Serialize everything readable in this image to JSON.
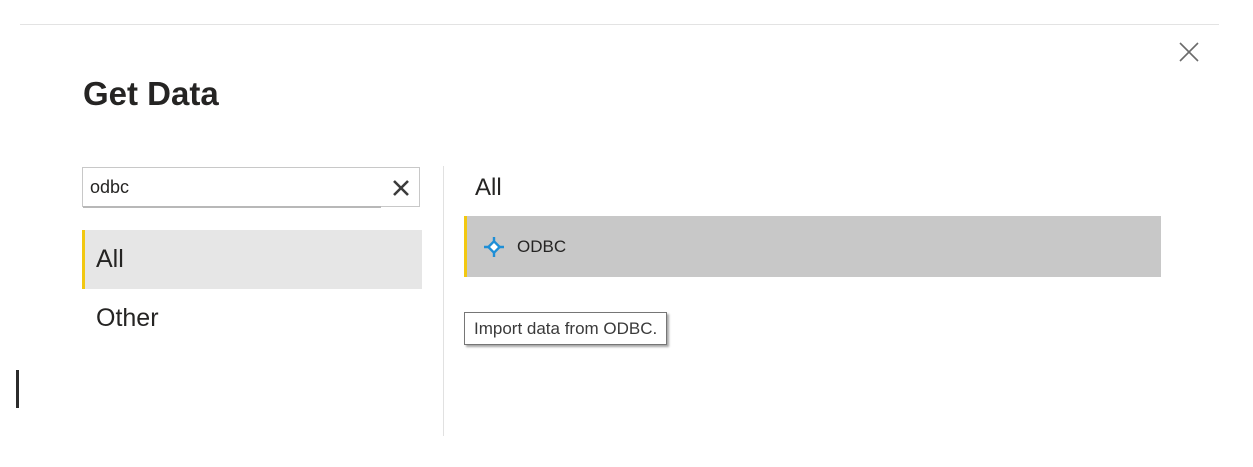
{
  "dialog": {
    "title": "Get Data",
    "close_icon": "close-icon"
  },
  "search": {
    "value": "odbc",
    "placeholder": "",
    "clear_icon": "clear-x-icon"
  },
  "categories": [
    {
      "label": "All",
      "selected": true
    },
    {
      "label": "Other",
      "selected": false
    }
  ],
  "results": {
    "heading": "All",
    "items": [
      {
        "label": "ODBC",
        "icon": "odbc-connector-icon",
        "selected": true
      }
    ]
  },
  "tooltip": {
    "text": "Import data from ODBC."
  },
  "colors": {
    "accent": "#f2c811",
    "selected_category_bg": "#e6e6e6",
    "selected_result_bg": "#c8c8c8",
    "icon_blue": "#1f8fd6"
  }
}
